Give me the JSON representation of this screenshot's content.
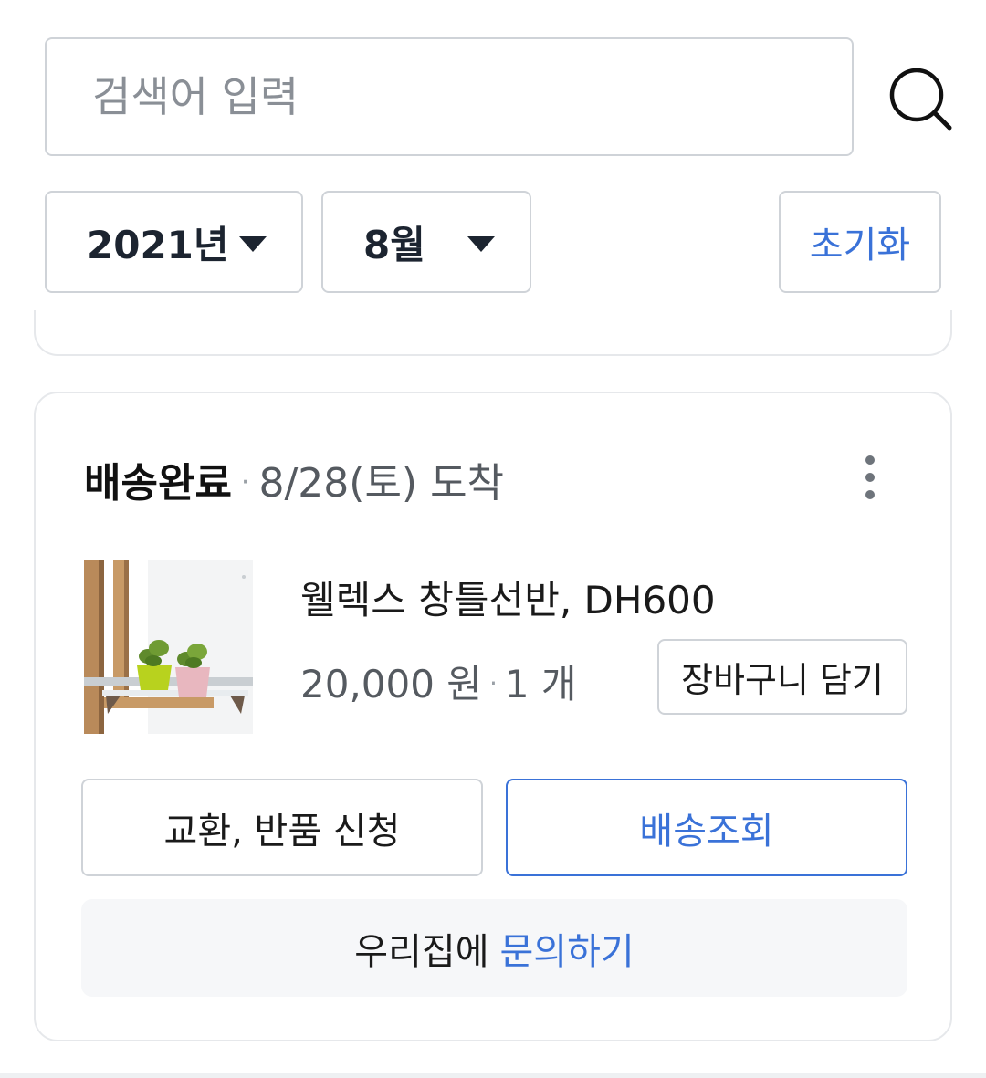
{
  "search": {
    "placeholder": "검색어 입력",
    "button_icon": "search-icon"
  },
  "filters": {
    "year": "2021년",
    "month": "8월",
    "reset_label": "초기화"
  },
  "order": {
    "status": "배송완료",
    "separator": "·",
    "arrival": "8/28(토) 도착",
    "more_icon": "more-vertical-icon",
    "product": {
      "name": "웰렉스 창틀선반, DH600",
      "price": "20,000 원",
      "quantity": "1 개",
      "cart_label": "장바구니 담기"
    },
    "actions": {
      "exchange_label": "교환, 반품 신청",
      "track_label": "배송조회",
      "inquiry_prefix": "우리집에",
      "inquiry_link": "문의하기"
    }
  },
  "colors": {
    "accent": "#3a72d8",
    "border": "#cfd3d8",
    "card_border": "#e6e8eb",
    "muted_text": "#555a60",
    "inquiry_bg": "#f6f7f9"
  }
}
